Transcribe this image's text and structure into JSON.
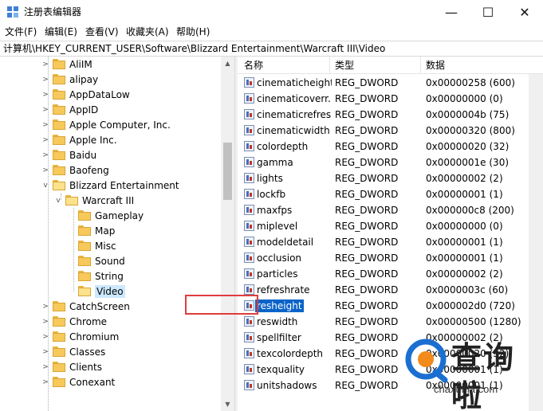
{
  "window": {
    "title": "注册表编辑器",
    "controls": {
      "minimize": "—",
      "maximize": "☐",
      "close": "✕"
    }
  },
  "menu": [
    "文件(F)",
    "编辑(E)",
    "查看(V)",
    "收藏夹(A)",
    "帮助(H)"
  ],
  "address": "计算机\\HKEY_CURRENT_USER\\Software\\Blizzard Entertainment\\Warcraft III\\Video",
  "tree": [
    {
      "label": "AliIM"
    },
    {
      "label": "alipay"
    },
    {
      "label": "AppDataLow"
    },
    {
      "label": "AppID"
    },
    {
      "label": "Apple Computer, Inc."
    },
    {
      "label": "Apple Inc."
    },
    {
      "label": "Baidu"
    },
    {
      "label": "Baofeng"
    },
    {
      "label": "Blizzard Entertainment"
    },
    {
      "label": "Warcraft III"
    },
    {
      "label": "Gameplay"
    },
    {
      "label": "Map"
    },
    {
      "label": "Misc"
    },
    {
      "label": "Sound"
    },
    {
      "label": "String"
    },
    {
      "label": "Video"
    },
    {
      "label": "CatchScreen"
    },
    {
      "label": "Chrome"
    },
    {
      "label": "Chromium"
    },
    {
      "label": "Classes"
    },
    {
      "label": "Clients"
    },
    {
      "label": "Conexant"
    }
  ],
  "columns": {
    "name": "名称",
    "type": "类型",
    "data": "数据"
  },
  "values": [
    {
      "name": "cinematicheight",
      "type": "REG_DWORD",
      "data": "0x00000258 (600)"
    },
    {
      "name": "cinematicoverr...",
      "type": "REG_DWORD",
      "data": "0x00000000 (0)"
    },
    {
      "name": "cinematicrefresh",
      "type": "REG_DWORD",
      "data": "0x0000004b (75)"
    },
    {
      "name": "cinematicwidth",
      "type": "REG_DWORD",
      "data": "0x00000320 (800)"
    },
    {
      "name": "colordepth",
      "type": "REG_DWORD",
      "data": "0x00000020 (32)"
    },
    {
      "name": "gamma",
      "type": "REG_DWORD",
      "data": "0x0000001e (30)"
    },
    {
      "name": "lights",
      "type": "REG_DWORD",
      "data": "0x00000002 (2)"
    },
    {
      "name": "lockfb",
      "type": "REG_DWORD",
      "data": "0x00000001 (1)"
    },
    {
      "name": "maxfps",
      "type": "REG_DWORD",
      "data": "0x000000c8 (200)"
    },
    {
      "name": "miplevel",
      "type": "REG_DWORD",
      "data": "0x00000000 (0)"
    },
    {
      "name": "modeldetail",
      "type": "REG_DWORD",
      "data": "0x00000001 (1)"
    },
    {
      "name": "occlusion",
      "type": "REG_DWORD",
      "data": "0x00000001 (1)"
    },
    {
      "name": "particles",
      "type": "REG_DWORD",
      "data": "0x00000002 (2)"
    },
    {
      "name": "refreshrate",
      "type": "REG_DWORD",
      "data": "0x0000003c (60)"
    },
    {
      "name": "resheight",
      "type": "REG_DWORD",
      "data": "0x000002d0 (720)"
    },
    {
      "name": "reswidth",
      "type": "REG_DWORD",
      "data": "0x00000500 (1280)"
    },
    {
      "name": "spellfilter",
      "type": "REG_DWORD",
      "data": "0x00000002 (2)"
    },
    {
      "name": "texcolordepth",
      "type": "REG_DWORD",
      "data": "0x00000020 (32)"
    },
    {
      "name": "texquality",
      "type": "REG_DWORD",
      "data": "0x00000001 (1)"
    },
    {
      "name": "unitshadows",
      "type": "REG_DWORD",
      "data": "0x00000001 (1)"
    }
  ],
  "watermark": {
    "text": "查询啦",
    "url": "chaxunla.com"
  },
  "colors": {
    "selection": "#0a64c8",
    "highlight_border": "#e03c3c",
    "folder": "#f7c95a"
  }
}
